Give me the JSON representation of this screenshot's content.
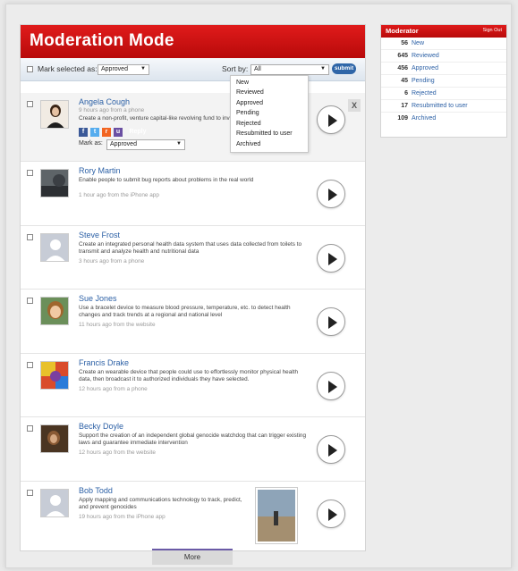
{
  "title": "Moderation Mode",
  "toolbar": {
    "mark_label": "Mark selected as:",
    "mark_value": "Approved",
    "sort_label": "Sort by:",
    "sort_value": "All",
    "submit_label": "submit"
  },
  "sort_options": [
    "New",
    "Reviewed",
    "Approved",
    "Pending",
    "Rejected",
    "Resubmitted to user",
    "Archived"
  ],
  "items": [
    {
      "name": "Angela Cough",
      "desc": "Create a non-profit, venture capital-like revolving fund to invest entrepreneurs.",
      "meta": "9 hours ago from a phone",
      "reply": "Reply",
      "mark_label": "Mark as:",
      "mark_value": "Approved",
      "close": "X"
    },
    {
      "name": "Rory Martin",
      "desc": "Enable people to submit bug reports about problems in the real world",
      "meta": "1 hour ago from the iPhone app"
    },
    {
      "name": "Steve Frost",
      "desc": "Create an integrated personal health data system that uses data collected from toilets to transmit and analyze health and nutritional data",
      "meta": "3 hours ago from a phone"
    },
    {
      "name": "Sue Jones",
      "desc": "Use a bracelet device to measure blood pressure, temperature, etc. to detect health changes and track trends at a regional and national level",
      "meta": "11 hours ago from the website"
    },
    {
      "name": "Francis Drake",
      "desc": "Create an wearable device that people could use to effortlessly monitor physical health data, then broadcast it to authorized individuals they have selected.",
      "meta": "12 hours ago from a phone"
    },
    {
      "name": "Becky Doyle",
      "desc": "Support the creation of an independent global genocide watchdog that can trigger existing laws and guarantee immediate intervention",
      "meta": "12 hours ago from the website"
    },
    {
      "name": "Bob Todd",
      "desc": "Apply mapping and communications technology to track, predict, and prevent genocides",
      "meta": "19 hours ago from the iPhone app"
    }
  ],
  "more_label": "More",
  "moderator": {
    "title": "Moderator",
    "signout": "Sign Out",
    "rows": [
      {
        "count": "56",
        "label": "New"
      },
      {
        "count": "645",
        "label": "Reviewed"
      },
      {
        "count": "456",
        "label": "Approved"
      },
      {
        "count": "45",
        "label": "Pending"
      },
      {
        "count": "6",
        "label": "Rejected"
      },
      {
        "count": "17",
        "label": "Resubmitted to user"
      },
      {
        "count": "109",
        "label": "Archived"
      }
    ]
  },
  "colors": {
    "brand_red": "#c8102e",
    "link_blue": "#2d61a6",
    "button_blue": "#2f66a8"
  }
}
